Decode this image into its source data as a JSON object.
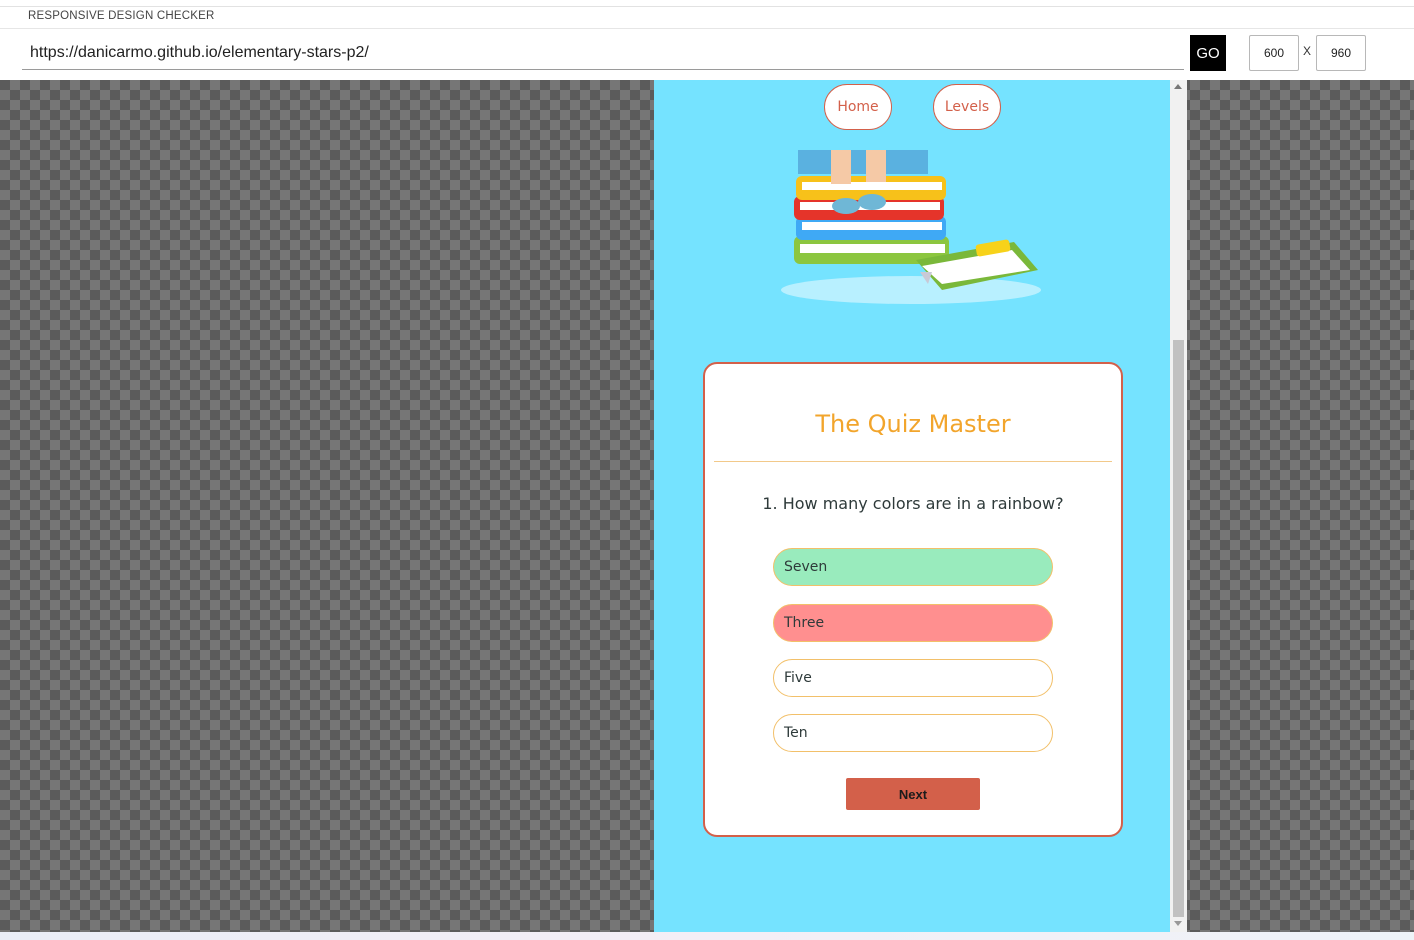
{
  "checker": {
    "title": "RESPONSIVE DESIGN CHECKER",
    "url": "https://danicarmo.github.io/elementary-stars-p2/",
    "go_label": "GO",
    "width_value": "600",
    "height_value": "960",
    "separator": "X"
  },
  "site": {
    "nav": {
      "home_label": "Home",
      "levels_label": "Levels"
    },
    "quiz": {
      "title": "The Quiz Master",
      "question": "1. How many colors are in a rainbow?",
      "answers": [
        {
          "label": "Seven",
          "state": "correct"
        },
        {
          "label": "Three",
          "state": "wrong"
        },
        {
          "label": "Five",
          "state": "default"
        },
        {
          "label": "Ten",
          "state": "default"
        }
      ],
      "next_label": "Next"
    }
  },
  "colors": {
    "site_background": "#75e3ff",
    "accent": "#d3604a",
    "title": "#f2a52c",
    "correct": "#99ebbd",
    "wrong": "#ff8f8f",
    "answer_border": "#f2c06a"
  }
}
